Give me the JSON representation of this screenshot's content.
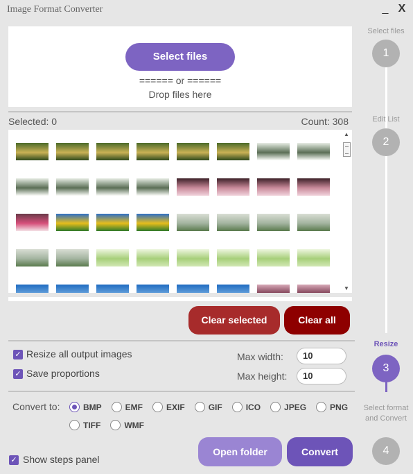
{
  "window": {
    "title": "Image Format Converter",
    "minimize_glyph": "_",
    "close_glyph": "X"
  },
  "dropzone": {
    "select_label": "Select files",
    "or_text": "====== or ======",
    "drop_text": "Drop files here"
  },
  "list": {
    "selected_label": "Selected: 0",
    "count_label": "Count: 308",
    "thumbnail_rows": [
      [
        "forest",
        "forest",
        "forest",
        "forest",
        "forest",
        "forest",
        "white-flowers",
        "white-flowers"
      ],
      [
        "white-flowers",
        "white-flowers",
        "white-flowers",
        "white-flowers",
        "pink-dark",
        "pink-dark",
        "pink-dark",
        "pink-dark"
      ],
      [
        "pink-flowers",
        "yellow-sky",
        "yellow-sky",
        "yellow-sky",
        "tulips",
        "tulips",
        "tulips",
        "tulips"
      ],
      [
        "tulips",
        "tulips",
        "light-green",
        "light-green",
        "light-green",
        "light-green",
        "light-green",
        "light-green"
      ],
      [
        "blue-sky",
        "blue-sky",
        "blue-sky",
        "blue-sky",
        "blue-sky",
        "blue-sky",
        "pink-blossom",
        "pink-blossom"
      ]
    ]
  },
  "actions": {
    "clear_selected": "Clear selected",
    "clear_all": "Clear all"
  },
  "resize": {
    "resize_all_label": "Resize all output images",
    "resize_all_checked": true,
    "save_proportions_label": "Save proportions",
    "save_proportions_checked": true,
    "max_width_label": "Max width:",
    "max_width_value": "10",
    "max_height_label": "Max height:",
    "max_height_value": "10"
  },
  "convert": {
    "label": "Convert to:",
    "selected": "BMP",
    "formats": [
      "BMP",
      "EMF",
      "EXIF",
      "GIF",
      "ICO",
      "JPEG",
      "PNG",
      "TIFF",
      "WMF"
    ]
  },
  "footer": {
    "show_steps_label": "Show steps panel",
    "show_steps_checked": true,
    "open_folder": "Open folder",
    "convert": "Convert"
  },
  "steps": [
    {
      "title": "Select files",
      "number": "1",
      "active": false
    },
    {
      "title": "Edit List",
      "number": "2",
      "active": false
    },
    {
      "title": "Resize",
      "number": "3",
      "active": true
    },
    {
      "title": "Select format and Convert",
      "number": "4",
      "active": false
    }
  ],
  "colors": {
    "accent": "#7d64c2",
    "accent_dark": "#6d54b8",
    "danger": "#a72b2b",
    "danger_dark": "#8e0000",
    "background": "#e6e6e6"
  },
  "thumbnail_palettes": {
    "forest": [
      "#4d6b2b",
      "#c9b155",
      "#2f4a1c"
    ],
    "white-flowers": [
      "#e6ece3",
      "#5b6f56",
      "#fbfcf9"
    ],
    "pink-dark": [
      "#3d2028",
      "#c98a9a",
      "#f1d3dc"
    ],
    "pink-flowers": [
      "#6b3b4a",
      "#d64f7a",
      "#f4e1e6"
    ],
    "yellow-sky": [
      "#2e6fc6",
      "#e6bd1c",
      "#2f7a2a"
    ],
    "tulips": [
      "#d9ddd4",
      "#a3b4a0",
      "#597a4c"
    ],
    "light-green": [
      "#eef6df",
      "#a7cf7a",
      "#d2e8b4"
    ],
    "blue-sky": [
      "#1f6bc1",
      "#69a4dc",
      "#d9e7f2"
    ],
    "pink-blossom": [
      "#d7aab8",
      "#7a3a50",
      "#f2e4e9"
    ]
  }
}
